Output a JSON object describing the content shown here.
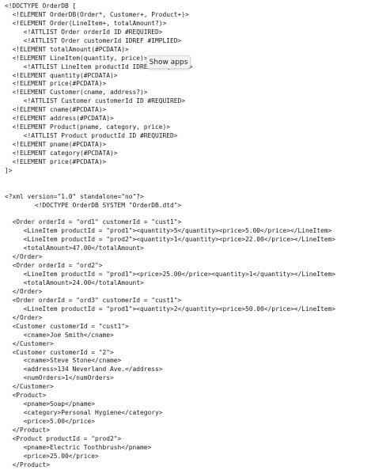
{
  "document": {
    "lines": [
      "<!DOCTYPE OrderDB [",
      "  <!ELEMENT OrderDB(Order*, Customer+, Product+)>",
      "  <!ELEMENT Order(LineItem+, totalAmount?)>",
      "     <!ATTLIST Order orderId ID #REQUIRED>",
      "     <!ATTLIST Order customerId IDREF #IMPLIED>",
      "  <!ELEMENT totalAmount(#PCDATA)>",
      "  <!ELEMENT LineItem(quantity, price)>",
      "     <!ATTLIST LineItem productId IDREF #REQUIRED>",
      "  <!ELEMENT quantity(#PCDATA)>",
      "  <!ELEMENT price(#PCDATA)>",
      "  <!ELEMENT Customer(cname, address?)>",
      "     <!ATTLIST Customer customerId ID #REQUIRED>",
      "  <!ELEMENT cname(#PCDATA)>",
      "  <!ELEMENT address(#PCDATA)>",
      "  <!ELEMENT Product(pname, category, price)>",
      "     <!ATTLIST Product productId ID #REQUIRED>",
      "  <!ELEMENT pname(#PCDATA)>",
      "  <!ELEMENT category(#PCDATA)>",
      "  <!ELEMENT price(#PCDATA)>",
      "]>",
      "",
      "",
      "<?xml version=\"1.0\" standalone=\"no\"?>",
      "        <!DOCTYPE OrderDB SYSTEM \"OrderDB.dtd\">",
      "",
      "  <Order orderId = \"ord1\" customerId = \"cust1\">",
      "     <LineItem productId = \"prod1\"><quantity>5</quantity><price>5.00</price></LineItem>",
      "     <LineItem productId = \"prod2\"><quantity>1</quantity><price>22.00</price></LineItem>",
      "     <totalAmount>47.00</totalAmount>",
      "  </Order>",
      "  <Order orderId = \"ord2\">",
      "     <LineItem productId = \"prod1\"><price>25.00</price><quantity>1</quantity></LineItem>",
      "     <totalAmount>24.00</totalAmount>",
      "  </Order>",
      "  <Order orderId = \"ord3\" customerId = \"cust1\">",
      "     <LineItem productId = \"prod1\"><quantity>2</quantity><price>50.00</price></LineItem>",
      "  </Order>",
      "  <Customer customerId = \"cust1\">",
      "     <cname>Joe Smith</cname>",
      "  </Customer>",
      "  <Customer customerId = \"2\">",
      "     <cname>Steve Stone</cname>",
      "     <address>134 Neverland Ave.</address>",
      "     <numOrders>1</numOrders>",
      "  </Customer>",
      "  <Product>",
      "     <pname>Soap</pname>",
      "     <category>Personal Hygiene</category>",
      "     <price>5.00</price>",
      "  </Product>",
      "  <Product productId = \"prod2\">",
      "     <pname>Electric Toothbrush</pname>",
      "     <price>25.00</price>",
      "  </Product>"
    ]
  },
  "tooltip": {
    "label": "Show apps"
  }
}
